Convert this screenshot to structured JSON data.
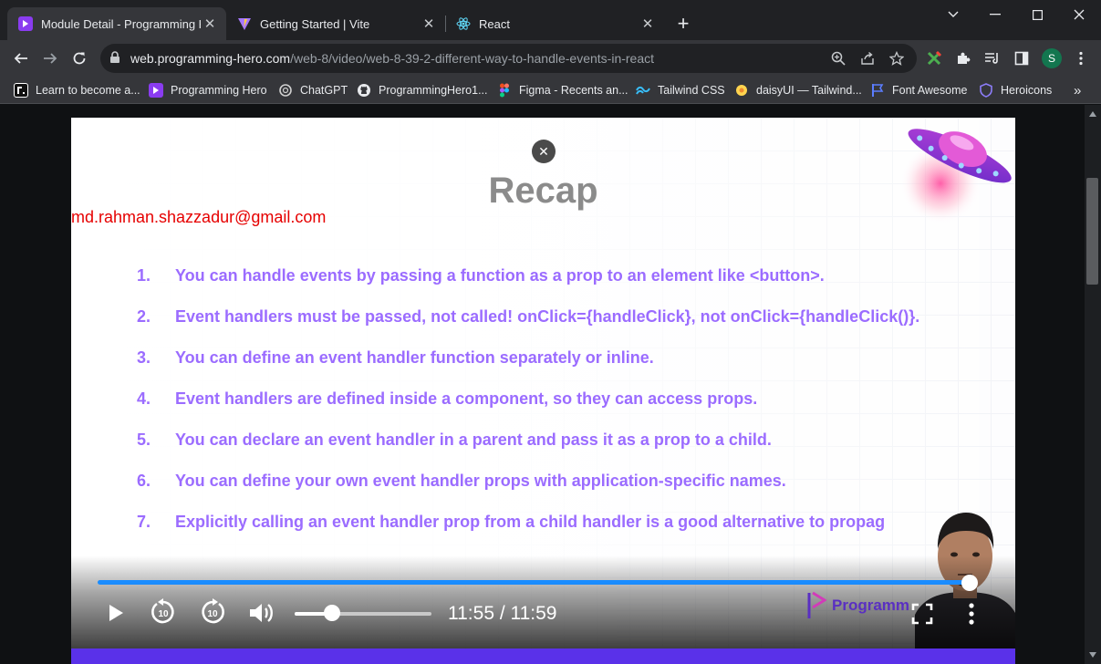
{
  "tabs": [
    {
      "title": "Module Detail - Programming Hero",
      "active": true
    },
    {
      "title": "Getting Started | Vite",
      "active": false
    },
    {
      "title": "React",
      "active": false
    }
  ],
  "address": {
    "host": "web.programming-hero.com",
    "path": "/web-8/video/web-8-39-2-different-way-to-handle-events-in-react"
  },
  "profile_initial": "S",
  "bookmarks": [
    {
      "label": "Learn to become a...",
      "icon": "r-logo-icon"
    },
    {
      "label": "Programming Hero",
      "icon": "programming-hero-icon"
    },
    {
      "label": "ChatGPT",
      "icon": "chatgpt-icon"
    },
    {
      "label": "ProgrammingHero1...",
      "icon": "github-icon"
    },
    {
      "label": "Figma - Recents an...",
      "icon": "figma-icon"
    },
    {
      "label": "Tailwind CSS",
      "icon": "tailwind-icon"
    },
    {
      "label": "daisyUI — Tailwind...",
      "icon": "daisyui-icon"
    },
    {
      "label": "Font Awesome",
      "icon": "font-awesome-icon"
    },
    {
      "label": "Heroicons",
      "icon": "heroicons-icon"
    }
  ],
  "slide": {
    "title": "Recap",
    "watermark_email": "md.rahman.shazzadur@gmail.com",
    "points": [
      {
        "num": "1.",
        "text": "You can handle events by passing a function as a prop to an element like <button>."
      },
      {
        "num": "2.",
        "text": "Event handlers must be passed, not called! onClick={handleClick}, not onClick={handleClick()}."
      },
      {
        "num": "3.",
        "text": "You can define an event handler function separately or inline."
      },
      {
        "num": "4.",
        "text": "Event handlers are defined inside a component, so they can access props."
      },
      {
        "num": "5.",
        "text": "You can declare an event handler in a parent and pass it as a prop to a child."
      },
      {
        "num": "6.",
        "text": "You can define your own event handler props with application-specific names."
      },
      {
        "num": "7.",
        "text": "Explicitly calling an event handler prop from a child handler is a good alternative to propag"
      }
    ],
    "logo_text": "Programm"
  },
  "player": {
    "current_time": "11:55",
    "duration": "11:59",
    "timecode": "11:55 / 11:59",
    "volume_fraction": 0.27,
    "progress_fraction": 0.994,
    "accent_color": "#1a8cff"
  },
  "colors": {
    "point_text": "#9b6cff",
    "recap_title": "#8b8b8b",
    "email": "#e60000",
    "brand_purple": "#5b2ee8"
  }
}
